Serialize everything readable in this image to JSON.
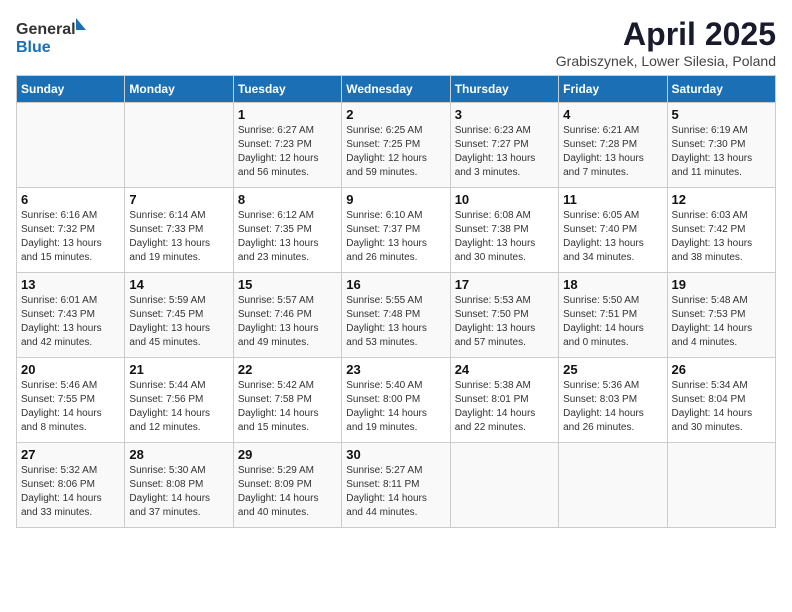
{
  "header": {
    "logo_general": "General",
    "logo_blue": "Blue",
    "title": "April 2025",
    "subtitle": "Grabiszynek, Lower Silesia, Poland"
  },
  "calendar": {
    "days_of_week": [
      "Sunday",
      "Monday",
      "Tuesday",
      "Wednesday",
      "Thursday",
      "Friday",
      "Saturday"
    ],
    "weeks": [
      [
        {
          "day": "",
          "sunrise": "",
          "sunset": "",
          "daylight": ""
        },
        {
          "day": "",
          "sunrise": "",
          "sunset": "",
          "daylight": ""
        },
        {
          "day": "1",
          "sunrise": "Sunrise: 6:27 AM",
          "sunset": "Sunset: 7:23 PM",
          "daylight": "Daylight: 12 hours and 56 minutes."
        },
        {
          "day": "2",
          "sunrise": "Sunrise: 6:25 AM",
          "sunset": "Sunset: 7:25 PM",
          "daylight": "Daylight: 12 hours and 59 minutes."
        },
        {
          "day": "3",
          "sunrise": "Sunrise: 6:23 AM",
          "sunset": "Sunset: 7:27 PM",
          "daylight": "Daylight: 13 hours and 3 minutes."
        },
        {
          "day": "4",
          "sunrise": "Sunrise: 6:21 AM",
          "sunset": "Sunset: 7:28 PM",
          "daylight": "Daylight: 13 hours and 7 minutes."
        },
        {
          "day": "5",
          "sunrise": "Sunrise: 6:19 AM",
          "sunset": "Sunset: 7:30 PM",
          "daylight": "Daylight: 13 hours and 11 minutes."
        }
      ],
      [
        {
          "day": "6",
          "sunrise": "Sunrise: 6:16 AM",
          "sunset": "Sunset: 7:32 PM",
          "daylight": "Daylight: 13 hours and 15 minutes."
        },
        {
          "day": "7",
          "sunrise": "Sunrise: 6:14 AM",
          "sunset": "Sunset: 7:33 PM",
          "daylight": "Daylight: 13 hours and 19 minutes."
        },
        {
          "day": "8",
          "sunrise": "Sunrise: 6:12 AM",
          "sunset": "Sunset: 7:35 PM",
          "daylight": "Daylight: 13 hours and 23 minutes."
        },
        {
          "day": "9",
          "sunrise": "Sunrise: 6:10 AM",
          "sunset": "Sunset: 7:37 PM",
          "daylight": "Daylight: 13 hours and 26 minutes."
        },
        {
          "day": "10",
          "sunrise": "Sunrise: 6:08 AM",
          "sunset": "Sunset: 7:38 PM",
          "daylight": "Daylight: 13 hours and 30 minutes."
        },
        {
          "day": "11",
          "sunrise": "Sunrise: 6:05 AM",
          "sunset": "Sunset: 7:40 PM",
          "daylight": "Daylight: 13 hours and 34 minutes."
        },
        {
          "day": "12",
          "sunrise": "Sunrise: 6:03 AM",
          "sunset": "Sunset: 7:42 PM",
          "daylight": "Daylight: 13 hours and 38 minutes."
        }
      ],
      [
        {
          "day": "13",
          "sunrise": "Sunrise: 6:01 AM",
          "sunset": "Sunset: 7:43 PM",
          "daylight": "Daylight: 13 hours and 42 minutes."
        },
        {
          "day": "14",
          "sunrise": "Sunrise: 5:59 AM",
          "sunset": "Sunset: 7:45 PM",
          "daylight": "Daylight: 13 hours and 45 minutes."
        },
        {
          "day": "15",
          "sunrise": "Sunrise: 5:57 AM",
          "sunset": "Sunset: 7:46 PM",
          "daylight": "Daylight: 13 hours and 49 minutes."
        },
        {
          "day": "16",
          "sunrise": "Sunrise: 5:55 AM",
          "sunset": "Sunset: 7:48 PM",
          "daylight": "Daylight: 13 hours and 53 minutes."
        },
        {
          "day": "17",
          "sunrise": "Sunrise: 5:53 AM",
          "sunset": "Sunset: 7:50 PM",
          "daylight": "Daylight: 13 hours and 57 minutes."
        },
        {
          "day": "18",
          "sunrise": "Sunrise: 5:50 AM",
          "sunset": "Sunset: 7:51 PM",
          "daylight": "Daylight: 14 hours and 0 minutes."
        },
        {
          "day": "19",
          "sunrise": "Sunrise: 5:48 AM",
          "sunset": "Sunset: 7:53 PM",
          "daylight": "Daylight: 14 hours and 4 minutes."
        }
      ],
      [
        {
          "day": "20",
          "sunrise": "Sunrise: 5:46 AM",
          "sunset": "Sunset: 7:55 PM",
          "daylight": "Daylight: 14 hours and 8 minutes."
        },
        {
          "day": "21",
          "sunrise": "Sunrise: 5:44 AM",
          "sunset": "Sunset: 7:56 PM",
          "daylight": "Daylight: 14 hours and 12 minutes."
        },
        {
          "day": "22",
          "sunrise": "Sunrise: 5:42 AM",
          "sunset": "Sunset: 7:58 PM",
          "daylight": "Daylight: 14 hours and 15 minutes."
        },
        {
          "day": "23",
          "sunrise": "Sunrise: 5:40 AM",
          "sunset": "Sunset: 8:00 PM",
          "daylight": "Daylight: 14 hours and 19 minutes."
        },
        {
          "day": "24",
          "sunrise": "Sunrise: 5:38 AM",
          "sunset": "Sunset: 8:01 PM",
          "daylight": "Daylight: 14 hours and 22 minutes."
        },
        {
          "day": "25",
          "sunrise": "Sunrise: 5:36 AM",
          "sunset": "Sunset: 8:03 PM",
          "daylight": "Daylight: 14 hours and 26 minutes."
        },
        {
          "day": "26",
          "sunrise": "Sunrise: 5:34 AM",
          "sunset": "Sunset: 8:04 PM",
          "daylight": "Daylight: 14 hours and 30 minutes."
        }
      ],
      [
        {
          "day": "27",
          "sunrise": "Sunrise: 5:32 AM",
          "sunset": "Sunset: 8:06 PM",
          "daylight": "Daylight: 14 hours and 33 minutes."
        },
        {
          "day": "28",
          "sunrise": "Sunrise: 5:30 AM",
          "sunset": "Sunset: 8:08 PM",
          "daylight": "Daylight: 14 hours and 37 minutes."
        },
        {
          "day": "29",
          "sunrise": "Sunrise: 5:29 AM",
          "sunset": "Sunset: 8:09 PM",
          "daylight": "Daylight: 14 hours and 40 minutes."
        },
        {
          "day": "30",
          "sunrise": "Sunrise: 5:27 AM",
          "sunset": "Sunset: 8:11 PM",
          "daylight": "Daylight: 14 hours and 44 minutes."
        },
        {
          "day": "",
          "sunrise": "",
          "sunset": "",
          "daylight": ""
        },
        {
          "day": "",
          "sunrise": "",
          "sunset": "",
          "daylight": ""
        },
        {
          "day": "",
          "sunrise": "",
          "sunset": "",
          "daylight": ""
        }
      ]
    ]
  }
}
